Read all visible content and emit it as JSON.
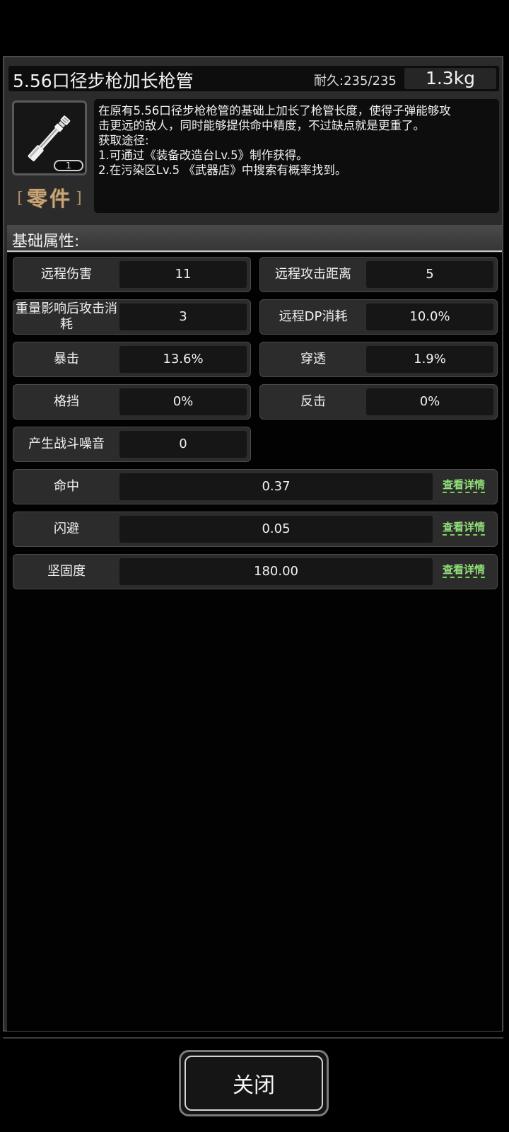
{
  "item": {
    "name": "5.56口径步枪加长枪管",
    "durability": "耐久:235/235",
    "weight": "1.3kg",
    "count": "1",
    "type_bracket_left": "[",
    "type": "零件",
    "type_bracket_right": "]",
    "description": [
      "在原有5.56口径步枪枪管的基础上加长了枪管长度，使得子弹能够攻",
      "击更远的敌人，同时能够提供命中精度，不过缺点就是更重了。",
      "获取途径:",
      "1.可通过《装备改造台Lv.5》制作获得。",
      "2.在污染区Lv.5 《武器店》中搜索有概率找到。"
    ]
  },
  "section": {
    "title": "基础属性:"
  },
  "stats": [
    {
      "label": "远程伤害",
      "value": "11"
    },
    {
      "label": "远程攻击距离",
      "value": "5"
    },
    {
      "label": "重量影响后攻击消耗",
      "value": "3"
    },
    {
      "label": "远程DP消耗",
      "value": "10.0%"
    },
    {
      "label": "暴击",
      "value": "13.6%"
    },
    {
      "label": "穿透",
      "value": "1.9%"
    },
    {
      "label": "格挡",
      "value": "0%"
    },
    {
      "label": "反击",
      "value": "0%"
    },
    {
      "label": "产生战斗噪音",
      "value": "0"
    }
  ],
  "detail_stats": [
    {
      "label": "命中",
      "value": "0.37",
      "link": "查看详情"
    },
    {
      "label": "闪避",
      "value": "0.05",
      "link": "查看详情"
    },
    {
      "label": "坚固度",
      "value": "180.00",
      "link": "查看详情"
    }
  ],
  "close_label": "关闭",
  "colors": {
    "item_type": "#c7a57a",
    "details_link": "#92e07a",
    "panel_bg": "#2b2b2b"
  },
  "icons": {
    "item_image": "rifle-barrel-icon"
  }
}
